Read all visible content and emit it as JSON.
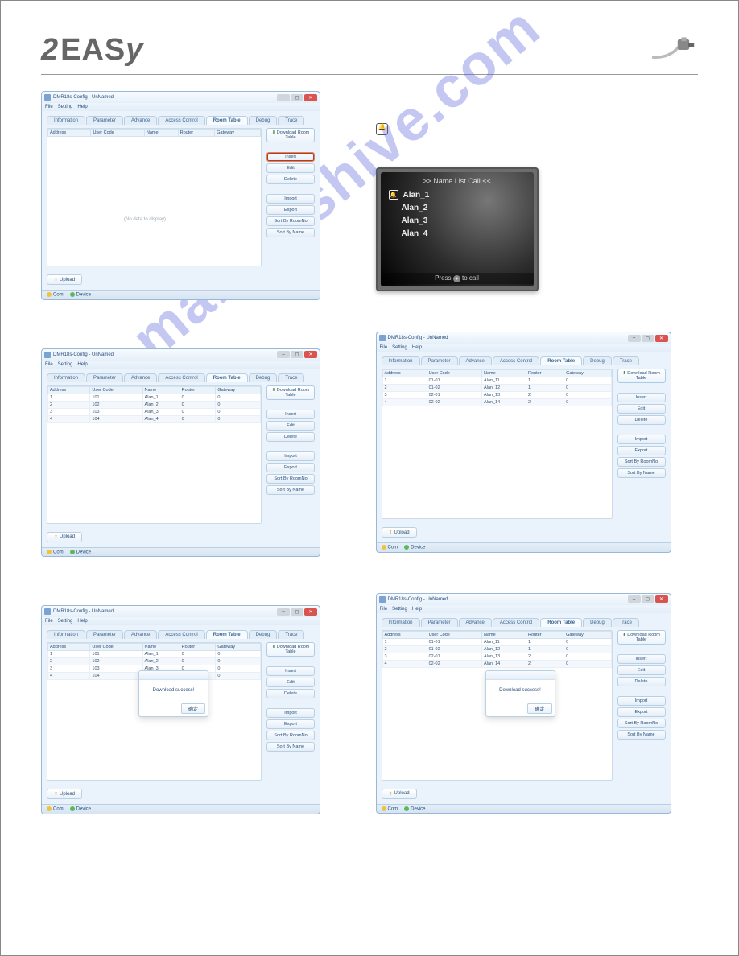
{
  "brand": "2EASY",
  "watermark": "manualshive.com",
  "win": {
    "title": "DMR18s-Config - UnNamed",
    "menu": [
      "File",
      "Setting",
      "Help"
    ],
    "tabs": [
      "Information",
      "Parameter",
      "Advance",
      "Access Control",
      "Room Table",
      "Debug",
      "Trace"
    ],
    "activeTab": "Room Table",
    "columns": [
      "Address",
      "User Code",
      "Name",
      "Router",
      "Gateway"
    ],
    "emptyMsg": "(No data to display)",
    "btnDownload": "Download Room Table",
    "btnInsert": "Insert",
    "btnEdit": "Edit",
    "btnDelete": "Delete",
    "btnImport": "Import",
    "btnExport": "Export",
    "btnSortR": "Sort By RoomNo",
    "btnSortN": "Sort By Name",
    "btnUpload": "Upload",
    "statusCom": "Com",
    "statusDevice": "Device"
  },
  "rowsA": [
    {
      "a": "1",
      "u": "101",
      "n": "Alan_1",
      "r": "0",
      "g": "0"
    },
    {
      "a": "2",
      "u": "102",
      "n": "Alan_2",
      "r": "0",
      "g": "0"
    },
    {
      "a": "3",
      "u": "103",
      "n": "Alan_3",
      "r": "0",
      "g": "0"
    },
    {
      "a": "4",
      "u": "104",
      "n": "Alan_4",
      "r": "0",
      "g": "0"
    }
  ],
  "rowsB": [
    {
      "a": "1",
      "u": "01-01",
      "n": "Alan_11",
      "r": "1",
      "g": "0"
    },
    {
      "a": "2",
      "u": "01-02",
      "n": "Alan_12",
      "r": "1",
      "g": "0"
    },
    {
      "a": "3",
      "u": "02-01",
      "n": "Alan_13",
      "r": "2",
      "g": "0"
    },
    {
      "a": "4",
      "u": "02-02",
      "n": "Alan_14",
      "r": "2",
      "g": "0"
    }
  ],
  "dialog": {
    "msg": "Download success!",
    "ok": "确定"
  },
  "device": {
    "title": ">> Name List Call <<",
    "items": [
      "Alan_1",
      "Alan_2",
      "Alan_3",
      "Alan_4"
    ],
    "hint_pre": "Press",
    "hint_icon": "●",
    "hint_post": "to call"
  }
}
